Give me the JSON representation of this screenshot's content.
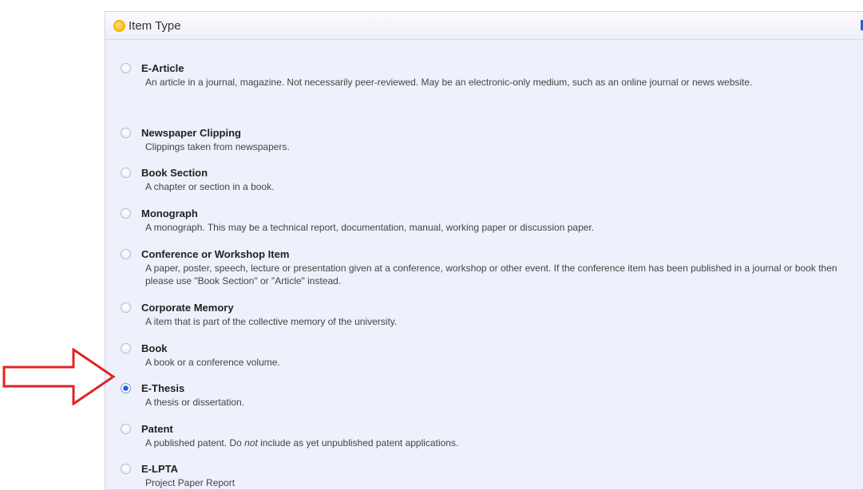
{
  "panel": {
    "title": "Item Type",
    "help_icon_label": "?"
  },
  "item_types": [
    {
      "title": "E-Article",
      "description": "An article in a journal, magazine. Not necessarily peer-reviewed. May be an electronic-only medium, such as an online journal or news website.",
      "selected": false
    },
    {
      "title": "Newspaper Clipping",
      "description": "Clippings taken from newspapers.",
      "selected": false
    },
    {
      "title": "Book Section",
      "description": "A chapter or section in a book.",
      "selected": false
    },
    {
      "title": "Monograph",
      "description": "A monograph. This may be a technical report, documentation, manual, working paper or discussion paper.",
      "selected": false
    },
    {
      "title": "Conference or Workshop Item",
      "description": "A paper, poster, speech, lecture or presentation given at a conference, workshop or other event. If the conference item has been published in a journal or book then please use \"Book Section\" or \"Article\" instead.",
      "selected": false
    },
    {
      "title": "Corporate Memory",
      "description": "A item that is part of the collective memory of the university.",
      "selected": false
    },
    {
      "title": "Book",
      "description": "A book or a conference volume.",
      "selected": false
    },
    {
      "title": "E-Thesis",
      "description": "A thesis or dissertation.",
      "selected": true
    },
    {
      "title": "Patent",
      "description_before": "A published patent. Do ",
      "description_em": "not",
      "description_after": " include as yet unpublished patent applications.",
      "selected": false
    },
    {
      "title": "E-LPTA",
      "description": "Project Paper Report",
      "selected": false
    }
  ],
  "colors": {
    "panel_bg": "#eef0fb",
    "arrow": "#e02424",
    "radio_selected": "#1f63d6"
  }
}
